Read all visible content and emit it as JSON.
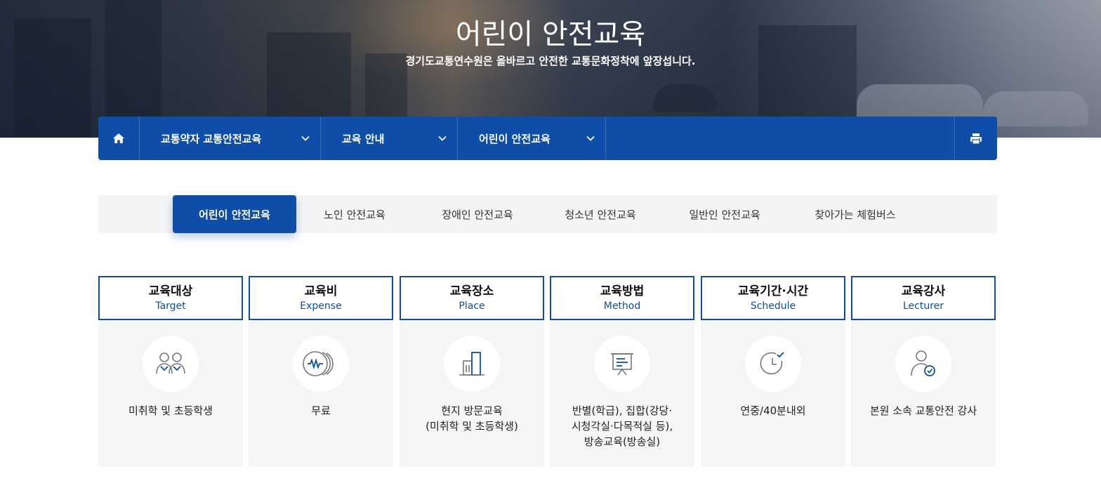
{
  "hero": {
    "title": "어린이 안전교육",
    "subtitle": "경기도교통연수원은 올바르고 안전한 교통문화정착에 앞장섭니다."
  },
  "nav": {
    "items": [
      {
        "label": "교통약자 교통안전교육"
      },
      {
        "label": "교육 안내"
      },
      {
        "label": "어린이 안전교육"
      }
    ]
  },
  "tabs": [
    {
      "label": "어린이 안전교육",
      "active": true
    },
    {
      "label": "노인 안전교육"
    },
    {
      "label": "장애인 안전교육"
    },
    {
      "label": "청소년 안전교육"
    },
    {
      "label": "일반인 안전교육"
    },
    {
      "label": "찾아가는 체험버스"
    }
  ],
  "cards": [
    {
      "title": "교육대상",
      "en": "Target",
      "icon": "people-icon",
      "lines": [
        "미취학 및 초등학생"
      ]
    },
    {
      "title": "교육비",
      "en": "Expense",
      "icon": "coin-icon",
      "lines": [
        "무료"
      ]
    },
    {
      "title": "교육장소",
      "en": "Place",
      "icon": "building-icon",
      "lines": [
        "현지 방문교육",
        "(미취학 및 초등학생)"
      ]
    },
    {
      "title": "교육방법",
      "en": "Method",
      "icon": "presentation-board-icon",
      "lines": [
        "반별(학급), 집합(강당·",
        "시청각실·다목적실 등),",
        "방송교육(방송실)"
      ]
    },
    {
      "title": "교육기간·시간",
      "en": "Schedule",
      "icon": "clock-check-icon",
      "lines": [
        "연중/40분내외"
      ]
    },
    {
      "title": "교육강사",
      "en": "Lecturer",
      "icon": "lecturer-icon",
      "lines": [
        "본원 소속 교통안전 강사"
      ]
    }
  ],
  "colors": {
    "primary": "#0e4ea8",
    "tab_bg": "#f3f4f6",
    "card_bg": "#f4f5f7"
  }
}
